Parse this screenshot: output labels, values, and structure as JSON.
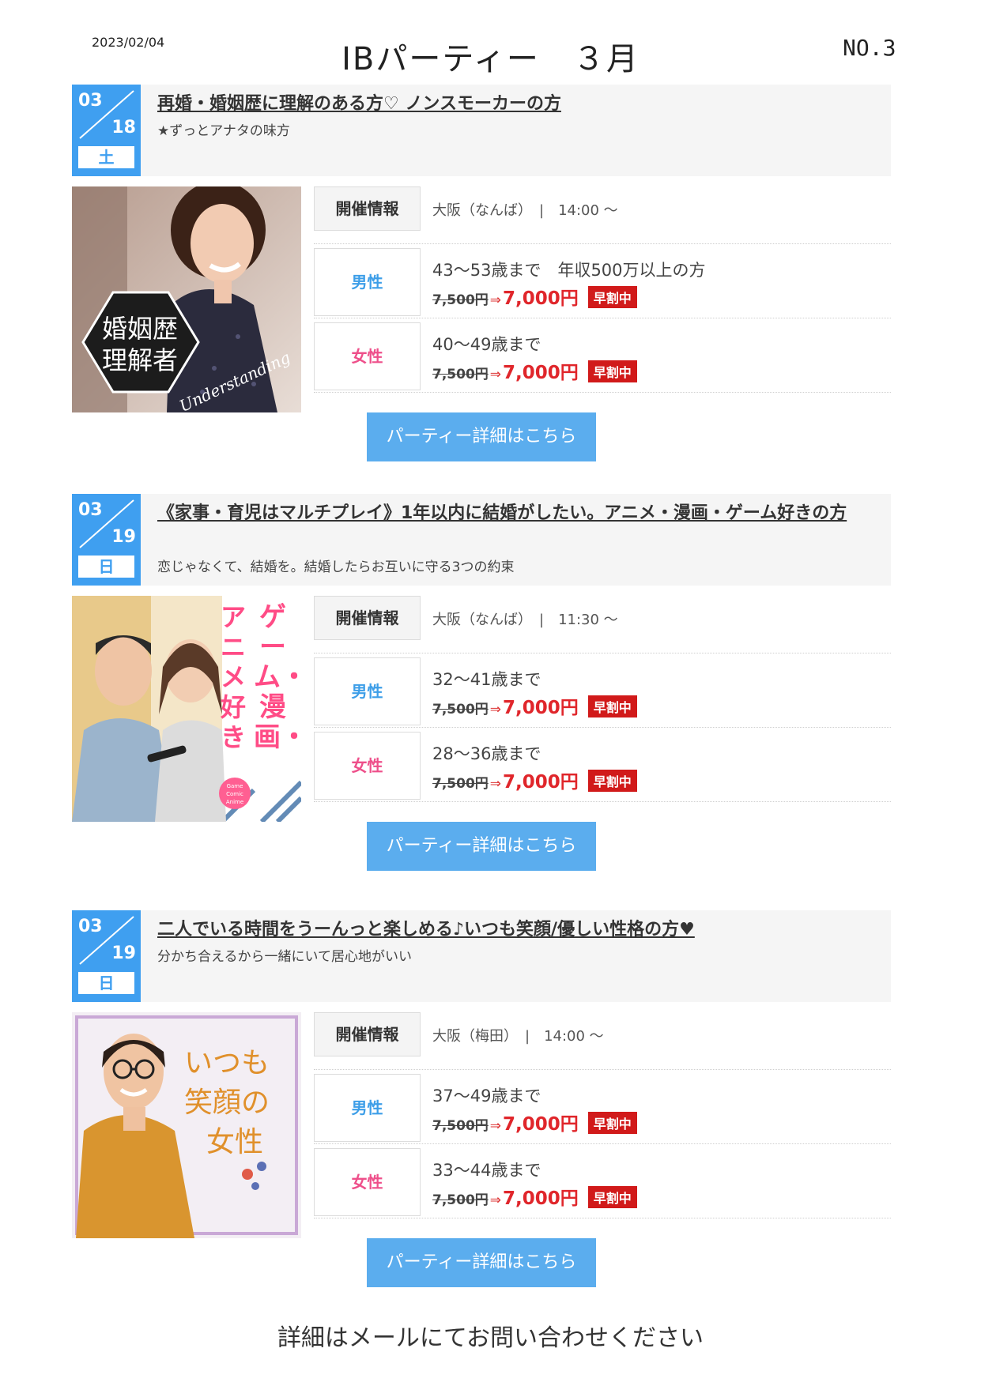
{
  "header": {
    "date": "2023/02/04",
    "title": "IBパーティー　３月",
    "number": "NO.3"
  },
  "events": [
    {
      "month": "03",
      "day": "18",
      "weekday": "土",
      "title": "再婚・婚姻歴に理解のある方♡ ノンスモーカーの方",
      "subtitle": "★ずっとアナタの味方",
      "photo_text": "婚姻歴理解者",
      "photo_text_line1": "婚姻歴",
      "photo_text_line2": "理解者",
      "photo_script": "Understanding",
      "info_label": "開催情報",
      "venue": "大阪（なんば）",
      "time": "14:00 ～",
      "male_label": "男性",
      "male_condition": "43～53歳まで　年収500万以上の方",
      "female_label": "女性",
      "female_condition": "40～49歳まで",
      "old_price": "7,500円",
      "new_price": "7,000円",
      "badge": "早割中",
      "button": "パーティー詳細はこちら"
    },
    {
      "month": "03",
      "day": "19",
      "weekday": "日",
      "title": "《家事・育児はマルチプレイ》1年以内に結婚がしたい。アニメ・漫画・ゲーム好きの方",
      "subtitle": "恋じゃなくて、結婚を。結婚したらお互いに守る3つの約束",
      "photo_text": "ゲーム・漫画・アニメ好き",
      "photo_col1": "ゲーム・漫画・",
      "photo_col2": "アニメ好き",
      "photo_badge": "Game Comic Anime",
      "info_label": "開催情報",
      "venue": "大阪（なんば）",
      "time": "11:30 ～",
      "male_label": "男性",
      "male_condition": "32～41歳まで",
      "female_label": "女性",
      "female_condition": "28～36歳まで",
      "old_price": "7,500円",
      "new_price": "7,000円",
      "badge": "早割中",
      "button": "パーティー詳細はこちら"
    },
    {
      "month": "03",
      "day": "19",
      "weekday": "日",
      "title": "二人でいる時間をうーんっと楽しめる♪いつも笑顔/優しい性格の方♥",
      "subtitle": "分かち合えるから一緒にいて居心地がいい",
      "photo_text": "いつも笑顔の女性",
      "photo_line1": "いつも",
      "photo_line2": "笑顔の",
      "photo_line3": "女性",
      "info_label": "開催情報",
      "venue": "大阪（梅田）",
      "time": "14:00 ～",
      "male_label": "男性",
      "male_condition": "37～49歳まで",
      "female_label": "女性",
      "female_condition": "33～44歳まで",
      "old_price": "7,500円",
      "new_price": "7,000円",
      "badge": "早割中",
      "button": "パーティー詳細はこちら"
    }
  ],
  "footer": {
    "text": "詳細はメールにてお問い合わせください"
  },
  "colors": {
    "accent_blue": "#3f9ff0",
    "button_blue": "#5badee",
    "price_red": "#e0262b",
    "male": "#3d9ee8",
    "female": "#ee4f8a"
  }
}
